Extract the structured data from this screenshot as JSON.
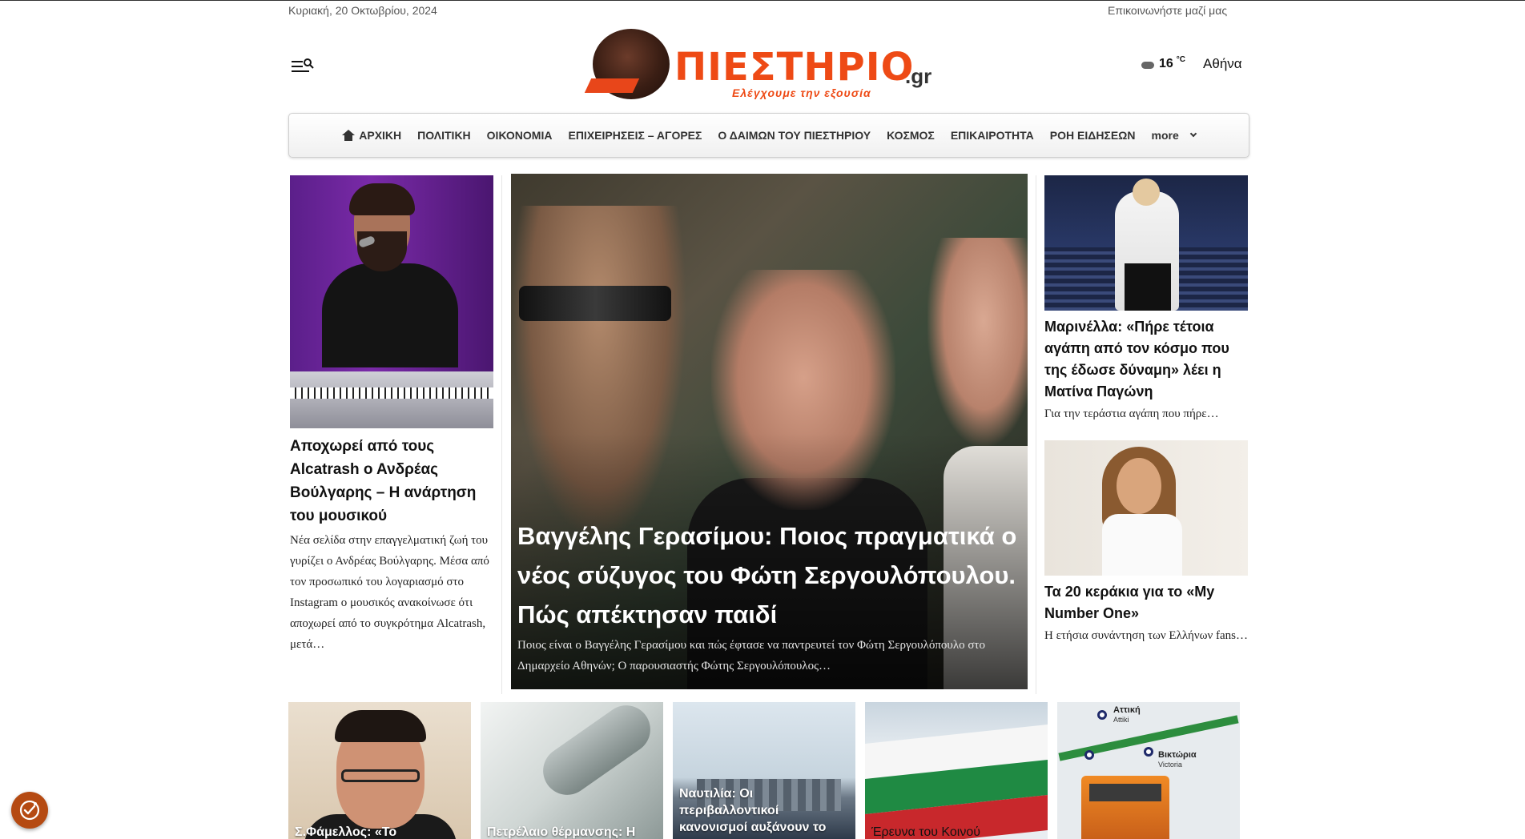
{
  "topbar": {
    "date": "Κυριακή, 20 Οκτωβρίου, 2024",
    "contact": "Επικοινωνήστε μαζί μας"
  },
  "header": {
    "logo_wordmark": "ΠΙΕΣΤΗΡΙΟ",
    "logo_suffix": ".gr",
    "logo_tagline": "Ελέγχουμε την εξουσία",
    "menu_icon": "menu-search-icon",
    "weather": {
      "icon": "cloud-icon",
      "temp": "16",
      "unit": "°C",
      "city": "Αθήνα"
    }
  },
  "nav": {
    "items": [
      {
        "label": "ΑΡΧΙΚΗ",
        "icon": "home-icon"
      },
      {
        "label": "ΠΟΛΙΤΙΚΗ"
      },
      {
        "label": "ΟΙΚΟΝΟΜΙΑ"
      },
      {
        "label": "ΕΠΙΧΕΙΡΗΣΕΙΣ – ΑΓΟΡΕΣ"
      },
      {
        "label": "Ο ΔΑΙΜΩΝ ΤΟΥ ΠΙΕΣΤΗΡΙΟΥ"
      },
      {
        "label": "ΚΟΣΜΟΣ"
      },
      {
        "label": "ΕΠΙΚΑΙΡΟΤΗΤΑ"
      },
      {
        "label": "ΡΟΗ ΕΙΔΗΣΕΩΝ"
      },
      {
        "label": "more",
        "icon": "chevron-down-icon"
      }
    ]
  },
  "left_article": {
    "title": "Αποχωρεί από τους Alcatrash ο Ανδρέας Βούλγαρης – Η ανάρτηση του μουσικού",
    "excerpt": "Νέα σελίδα στην επαγγελματική ζωή του γυρίζει ο Ανδρέας Βούλγαρης. Μέσα από τον προσωπικό του λογαριασμό στο Instagram ο μουσικός ανακοίνωσε ότι αποχωρεί από το συγκρότημα Alcatrash, μετά…"
  },
  "main_article": {
    "title": "Βαγγέλης Γερασίμου: Ποιος πραγματικά ο νέος σύζυγος του Φώτη Σεργουλόπουλου. Πώς απέκτησαν παιδί",
    "excerpt": "Ποιος είναι ο Βαγγέλης Γερασίμου και πώς έφτασε να παντρευτεί τον Φώτη Σεργουλόπουλο στο Δημαρχείο Αθηνών; Ο παρουσιαστής Φώτης Σεργουλόπουλος…"
  },
  "right_articles": [
    {
      "title": "Μαρινέλλα: «Πήρε τέτοια αγάπη από τον κόσμο που της έδωσε δύναμη» λέει η Ματίνα Παγώνη",
      "excerpt": "Για την τεράστια αγάπη που πήρε…"
    },
    {
      "title": "Τα 20 κεράκια για το «My Number One»",
      "excerpt": "Η ετήσια συνάντηση των Ελλήνων fans…"
    }
  ],
  "bottom_cards": [
    {
      "caption": "Σ.Φάμελλος: «Το"
    },
    {
      "caption": "Πετρέλαιο θέρμανσης: Η"
    },
    {
      "caption": "Ναυτιλία: Οι περιβαλλοντικοί κανονισμοί αυξάνουν το"
    },
    {
      "caption": "Έρευνα του Κοινού"
    },
    {
      "caption": ""
    }
  ],
  "map_labels": {
    "station1": "Αττική",
    "station1_en": "Attiki",
    "station2": "Βικτώρια",
    "station2_en": "Victoria"
  },
  "colors": {
    "brand_orange": "#ee4a15",
    "nav_text": "#333333",
    "settings_button": "#b54a12"
  }
}
